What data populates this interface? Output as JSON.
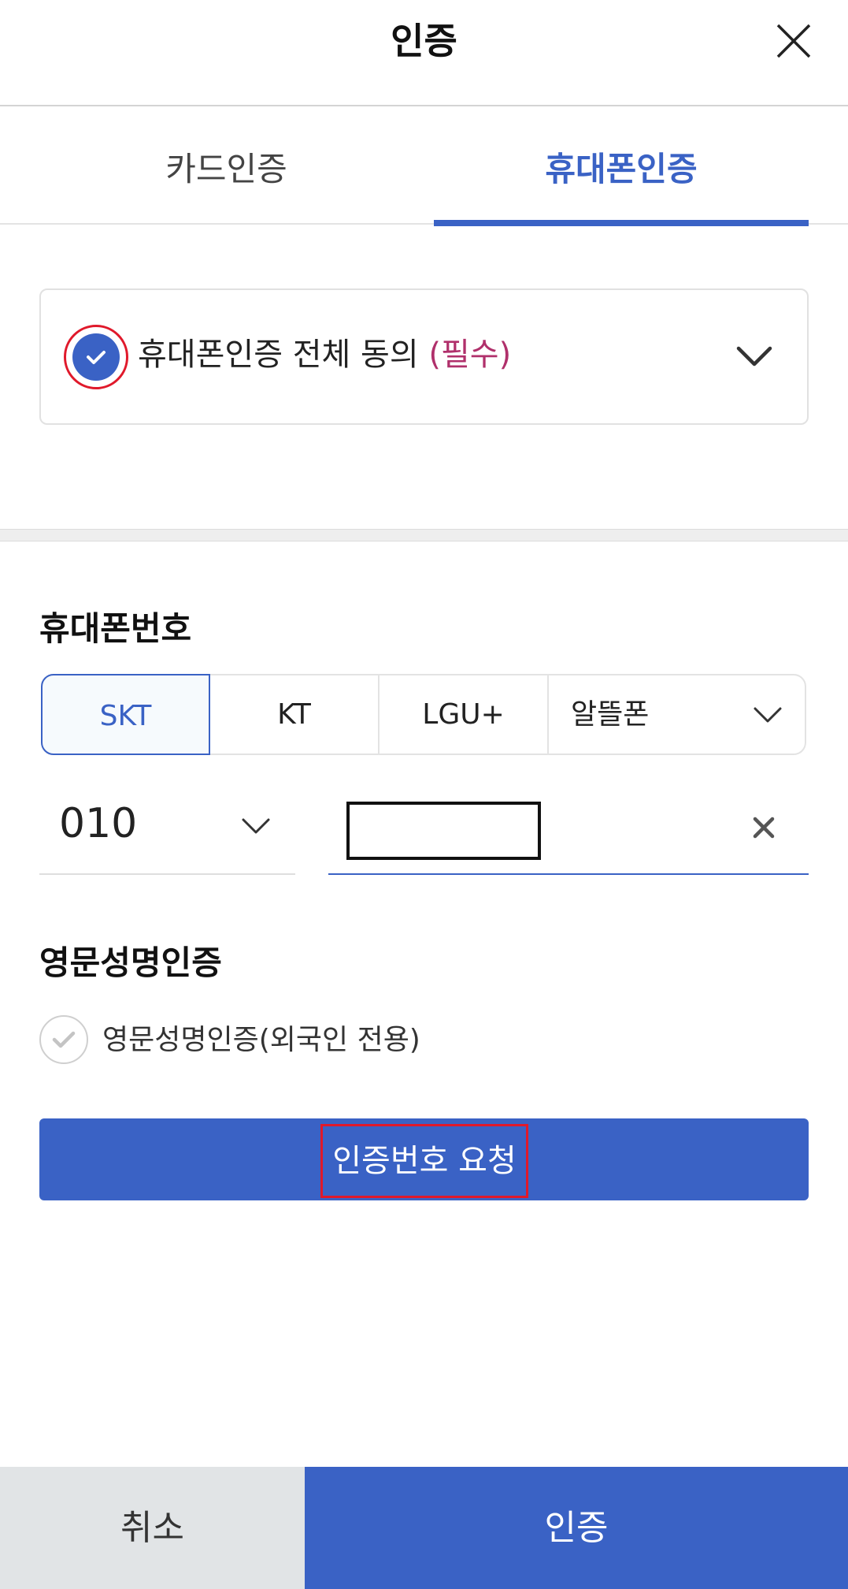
{
  "header": {
    "title": "인증",
    "close_icon": "close-icon"
  },
  "tabs": [
    {
      "label": "카드인증",
      "active": false
    },
    {
      "label": "휴대폰인증",
      "active": true
    }
  ],
  "consent": {
    "label": "휴대폰인증 전체 동의",
    "required_label": "(필수)",
    "checked": true,
    "icon": "check-icon",
    "expand_icon": "chevron-down-icon"
  },
  "phone": {
    "section_label": "휴대폰번호",
    "carriers": [
      {
        "label": "SKT",
        "selected": true
      },
      {
        "label": "KT",
        "selected": false
      },
      {
        "label": "LGU+",
        "selected": false
      },
      {
        "label": "알뜰폰",
        "selected": false
      }
    ],
    "prefix": "010",
    "number_value": "",
    "clear_icon": "clear-icon"
  },
  "english_name": {
    "section_label": "영문성명인증",
    "option_label": "영문성명인증(외국인 전용)",
    "checked": false
  },
  "request_button": {
    "label": "인증번호 요청"
  },
  "bottom": {
    "cancel_label": "취소",
    "confirm_label": "인증"
  },
  "colors": {
    "accent": "#3a62c5",
    "required": "#b0306b",
    "highlight": "#e0192b",
    "cancel_bg": "#e1e4e6"
  }
}
